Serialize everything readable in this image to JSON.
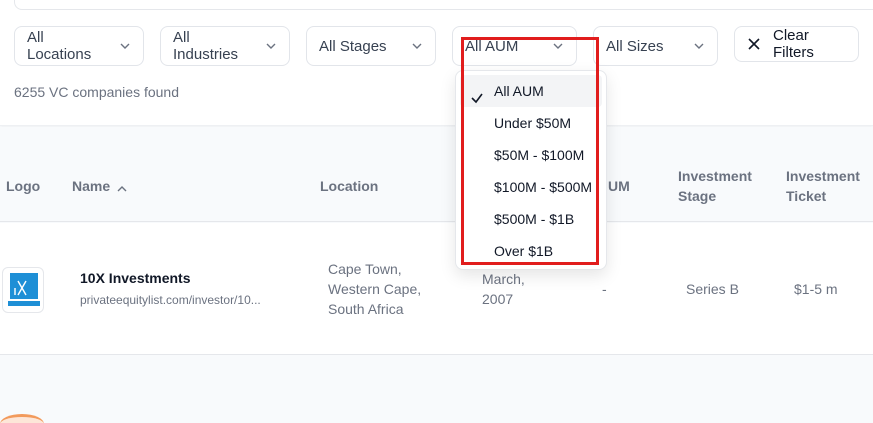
{
  "filters": {
    "locations": "All Locations",
    "industries": "All Industries",
    "stages": "All Stages",
    "aum": "All AUM",
    "sizes": "All Sizes",
    "clear": "Clear Filters"
  },
  "results_count": "6255 VC companies found",
  "table": {
    "headers": {
      "logo": "Logo",
      "name": "Name",
      "location": "Location",
      "aum": "UM",
      "stage_line1": "Investment",
      "stage_line2": "Stage",
      "ticket_line1": "Investment",
      "ticket_line2": "Ticket"
    },
    "rows": [
      {
        "name": "10X Investments",
        "url": "privateequitylist.com/investor/10...",
        "location_line1": "Cape Town,",
        "location_line2": "Western Cape,",
        "location_line3": "South Africa",
        "founded_line1": "March,",
        "founded_line2": "2007",
        "aum": "-",
        "stage": "Series B",
        "ticket": "$1-5 m"
      }
    ]
  },
  "aum_dropdown": {
    "selected": "All AUM",
    "options": [
      "All AUM",
      "Under $50M",
      "$50M - $100M",
      "$100M - $500M",
      "$500M - $1B",
      "Over $1B"
    ]
  },
  "colors": {
    "highlight": "#e11d1d",
    "logo_blue": "#1e8fd6"
  },
  "icons": [
    "chevron-down-icon",
    "chevron-up-icon",
    "close-icon",
    "check-icon"
  ]
}
